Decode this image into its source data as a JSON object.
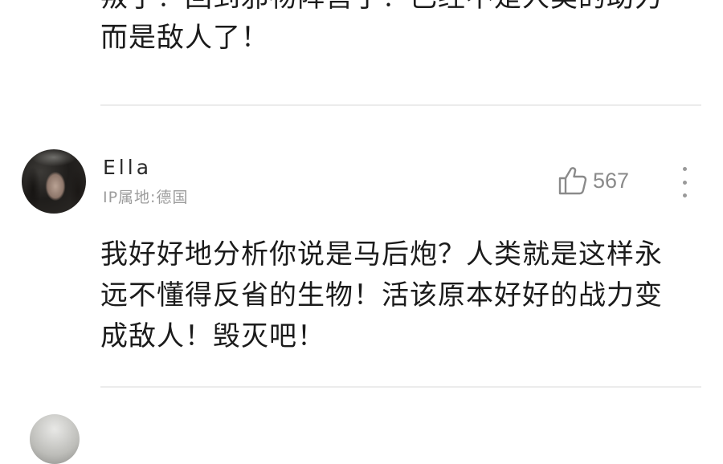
{
  "previous_comment": {
    "text": "叛了！回到邪物阵营了！已经不是人类的助力而是敌人了！"
  },
  "comment": {
    "username": "Ella",
    "ip_location": "IP属地:德国",
    "like_count": "567",
    "text": "我好好地分析你说是马后炮？人类就是这样永远不懂得反省的生物！活该原本好好的战力变成敌人！毁灭吧！"
  },
  "icons": {
    "like": "thumbs-up-icon",
    "more": "more-vertical-icon"
  },
  "colors": {
    "text": "#1b1b1b",
    "secondary": "#9c9c9c",
    "divider": "#ececec"
  }
}
